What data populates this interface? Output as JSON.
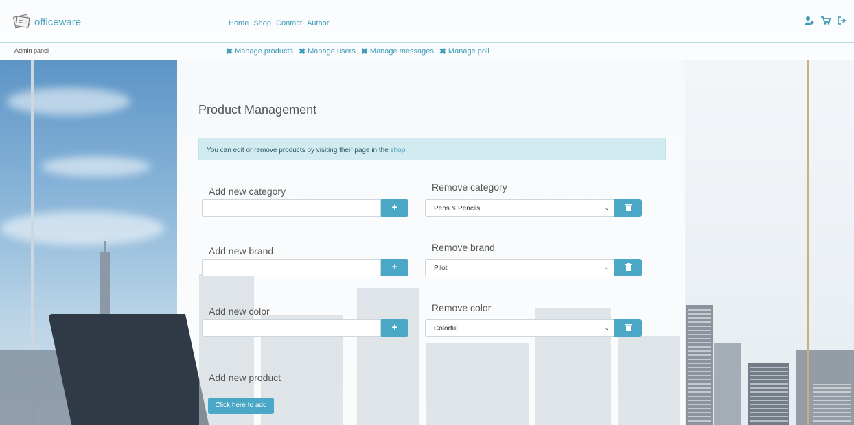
{
  "brand": {
    "name": "officeware"
  },
  "nav": {
    "links": [
      "Home",
      "Shop",
      "Contact",
      "Author"
    ]
  },
  "navIcons": [
    "user-admin-icon",
    "cart-icon",
    "logout-icon"
  ],
  "subbar": {
    "label": "Admin panel",
    "links": [
      "Manage products",
      "Manage users",
      "Manage messages",
      "Manage poll"
    ]
  },
  "page": {
    "title": "Product Management",
    "alert_prefix": "You can edit or remove products by visiting their page in the ",
    "alert_link": "shop",
    "alert_suffix": "."
  },
  "forms": {
    "category": {
      "add_label": "Add new category",
      "remove_label": "Remove category",
      "selected": "Pens & Pencils"
    },
    "brand": {
      "add_label": "Add new brand",
      "remove_label": "Remove brand",
      "selected": "Pilot"
    },
    "color": {
      "add_label": "Add new color",
      "remove_label": "Remove color",
      "selected": "Colorful"
    }
  },
  "product": {
    "label": "Add new product",
    "button": "Click here to add"
  },
  "colors": {
    "accent": "#4aa8c6",
    "link": "#3d9bb8",
    "alert_bg": "#d2ebf0"
  }
}
